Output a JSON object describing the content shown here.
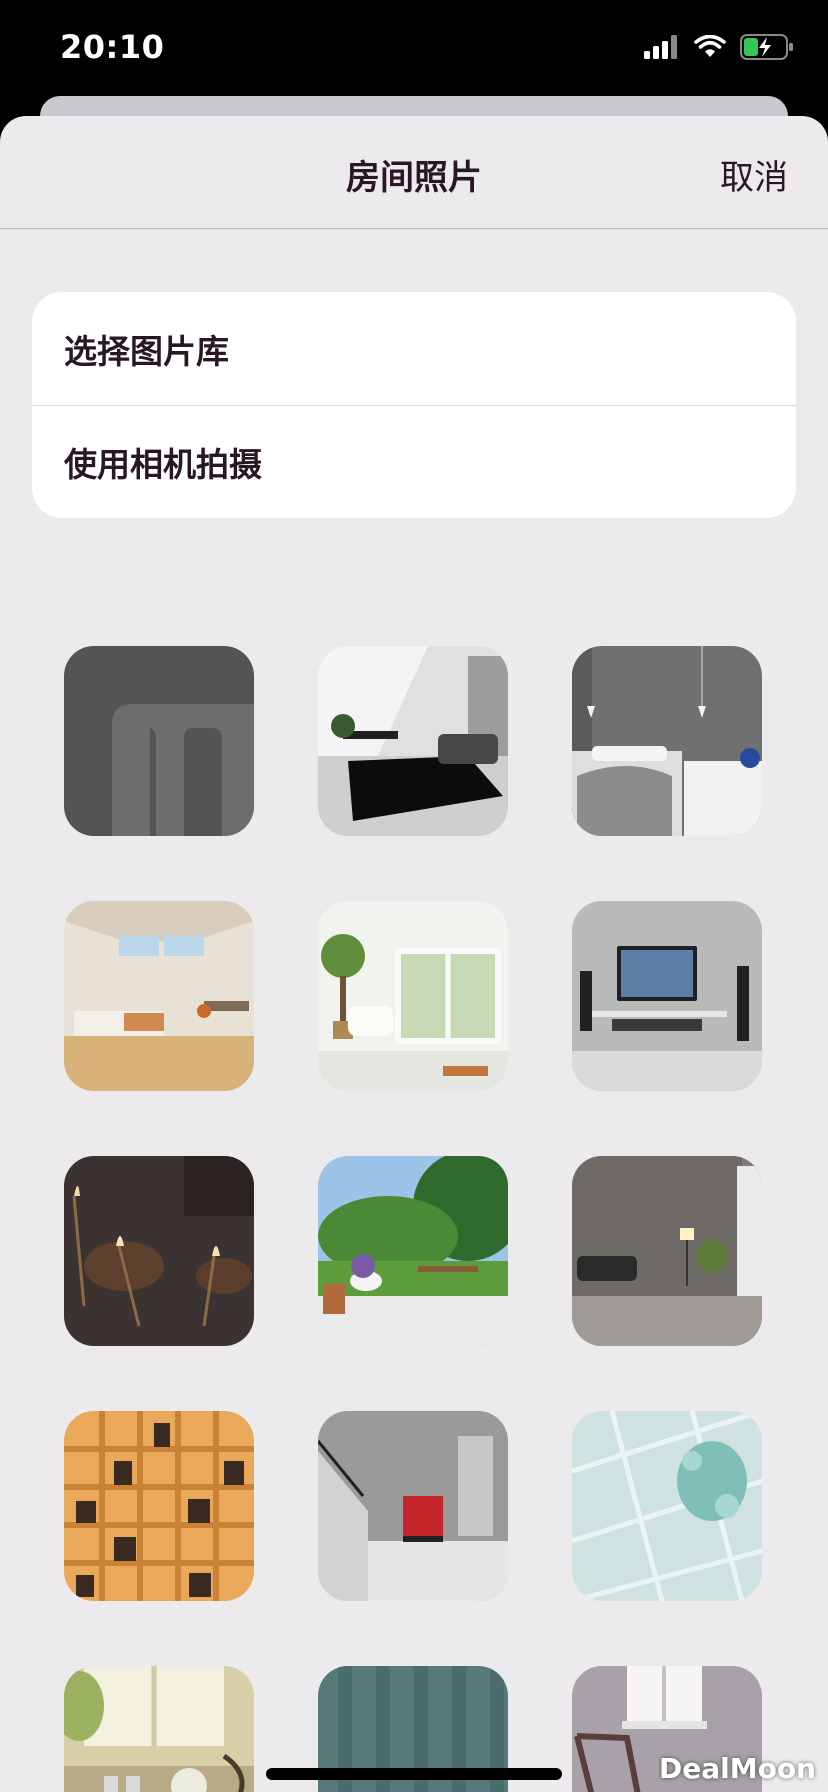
{
  "status_bar": {
    "time": "20:10"
  },
  "sheet": {
    "title": "房间照片",
    "cancel_label": "取消"
  },
  "menu": {
    "items": [
      {
        "label": "选择图片库"
      },
      {
        "label": "使用相机拍摄"
      }
    ]
  },
  "photos": [
    {
      "name": "logo-m"
    },
    {
      "name": "living-room-bw"
    },
    {
      "name": "bedroom-grey"
    },
    {
      "name": "attic-bedroom"
    },
    {
      "name": "sunroom"
    },
    {
      "name": "tv-room"
    },
    {
      "name": "chandelier"
    },
    {
      "name": "garden-patio"
    },
    {
      "name": "wood-wall-lounge"
    },
    {
      "name": "bookshelf"
    },
    {
      "name": "garage-stairs"
    },
    {
      "name": "glass-tiles"
    },
    {
      "name": "kitchen-window"
    },
    {
      "name": "teal-planks"
    },
    {
      "name": "rocking-chair-room"
    }
  ],
  "watermark": "DealMoon"
}
